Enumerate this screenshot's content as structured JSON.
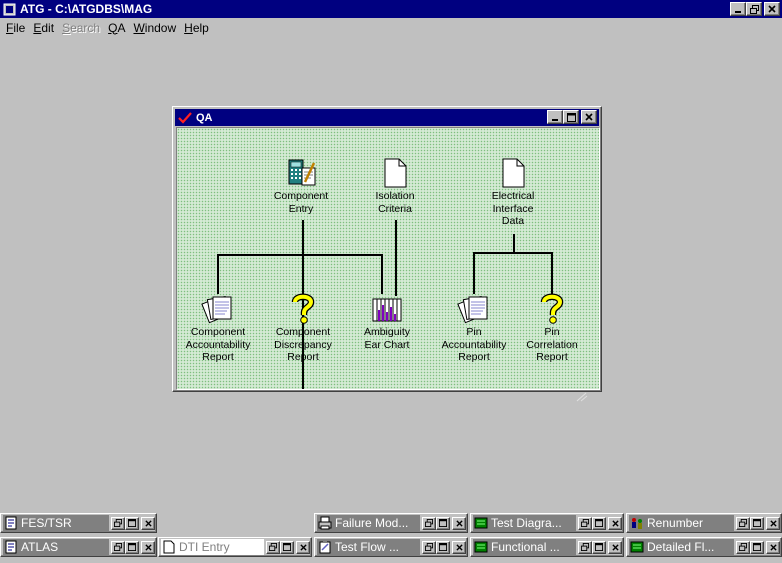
{
  "app": {
    "title": "ATG - C:\\ATGDBS\\MAG"
  },
  "menu": [
    {
      "key": "F",
      "rest": "ile",
      "disabled": false
    },
    {
      "key": "E",
      "rest": "dit",
      "disabled": false
    },
    {
      "key": "S",
      "rest": "earch",
      "disabled": true
    },
    {
      "key": "Q",
      "rest": "A",
      "disabled": false
    },
    {
      "key": "W",
      "rest": "indow",
      "disabled": false
    },
    {
      "key": "H",
      "rest": "elp",
      "disabled": false
    }
  ],
  "qa_window": {
    "title": "QA",
    "nodes": {
      "component_entry": {
        "line1": "Component",
        "line2": "Entry",
        "line3": ""
      },
      "isolation_criteria": {
        "line1": "Isolation",
        "line2": "Criteria",
        "line3": ""
      },
      "electrical_interface_data": {
        "line1": "Electrical",
        "line2": "Interface",
        "line3": "Data"
      },
      "component_accountability_report": {
        "line1": "Component",
        "line2": "Accountability",
        "line3": "Report"
      },
      "component_discrepancy_report": {
        "line1": "Component",
        "line2": "Discrepancy",
        "line3": "Report"
      },
      "ambiguity_ear_chart": {
        "line1": "Ambiguity",
        "line2": "Ear Chart",
        "line3": ""
      },
      "pin_accountability_report": {
        "line1": "Pin",
        "line2": "Accountability",
        "line3": "Report"
      },
      "pin_correlation_report": {
        "line1": "Pin",
        "line2": "Correlation",
        "line3": "Report"
      }
    }
  },
  "minimized": {
    "row1": [
      {
        "title": "FES/TSR",
        "icon": "doc-icon"
      },
      {
        "title": "Failure Mod...",
        "icon": "printer-icon"
      },
      {
        "title": "Test Diagra...",
        "icon": "board-icon"
      },
      {
        "title": "Renumber",
        "icon": "people-icon"
      }
    ],
    "row2": [
      {
        "title": "ATLAS",
        "icon": "doc-icon"
      },
      {
        "title": "DTI Entry",
        "icon": "page-icon"
      },
      {
        "title": "Test Flow ...",
        "icon": "clipboard-icon"
      },
      {
        "title": "Functional ...",
        "icon": "board-icon"
      },
      {
        "title": "Detailed Fl...",
        "icon": "board-icon"
      }
    ]
  }
}
